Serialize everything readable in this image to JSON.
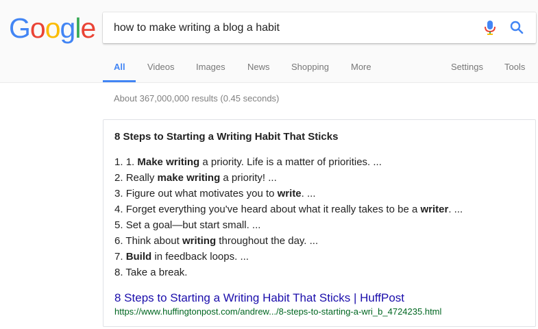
{
  "logo": {
    "letters": [
      "G",
      "o",
      "o",
      "g",
      "l",
      "e"
    ],
    "colors": [
      "#4285f4",
      "#ea4335",
      "#fbbc05",
      "#4285f4",
      "#34a853",
      "#ea4335"
    ]
  },
  "search": {
    "query": "how to make writing a blog a habit",
    "mic_icon": "microphone-icon",
    "search_icon": "search-icon"
  },
  "tabs": {
    "items": [
      "All",
      "Videos",
      "Images",
      "News",
      "Shopping",
      "More"
    ],
    "active": "All",
    "settings": "Settings",
    "tools": "Tools"
  },
  "results": {
    "stats": "About 367,000,000 results (0.45 seconds)"
  },
  "featured_snippet": {
    "title": "8 Steps to Starting a Writing Habit That Sticks",
    "steps": [
      {
        "num": "1.",
        "parts": [
          {
            "t": "1. ",
            "b": false
          },
          {
            "t": "Make writing",
            "b": true
          },
          {
            "t": " a priority. Life is a matter of priorities. ...",
            "b": false
          }
        ]
      },
      {
        "num": "2.",
        "parts": [
          {
            "t": "Really ",
            "b": false
          },
          {
            "t": "make writing",
            "b": true
          },
          {
            "t": " a priority! ...",
            "b": false
          }
        ]
      },
      {
        "num": "3.",
        "parts": [
          {
            "t": "Figure out what motivates you to ",
            "b": false
          },
          {
            "t": "write",
            "b": true
          },
          {
            "t": ". ...",
            "b": false
          }
        ]
      },
      {
        "num": "4.",
        "parts": [
          {
            "t": "Forget everything you've heard about what it really takes to be a ",
            "b": false
          },
          {
            "t": "writer",
            "b": true
          },
          {
            "t": ". ...",
            "b": false
          }
        ]
      },
      {
        "num": "5.",
        "parts": [
          {
            "t": "Set a goal—but start small. ...",
            "b": false
          }
        ]
      },
      {
        "num": "6.",
        "parts": [
          {
            "t": "Think about ",
            "b": false
          },
          {
            "t": "writing",
            "b": true
          },
          {
            "t": " throughout the day. ...",
            "b": false
          }
        ]
      },
      {
        "num": "7.",
        "parts": [
          {
            "t": "Build",
            "b": true
          },
          {
            "t": " in feedback loops. ...",
            "b": false
          }
        ]
      },
      {
        "num": "8.",
        "parts": [
          {
            "t": "Take a break.",
            "b": false
          }
        ]
      }
    ],
    "link_text": "8 Steps to Starting a Writing Habit That Sticks | HuffPost",
    "url": "https://www.huffingtonpost.com/andrew.../8-steps-to-starting-a-wri_b_4724235.html"
  },
  "colors": {
    "link": "#1a0dab",
    "url": "#006621",
    "active_tab": "#4285f4"
  }
}
